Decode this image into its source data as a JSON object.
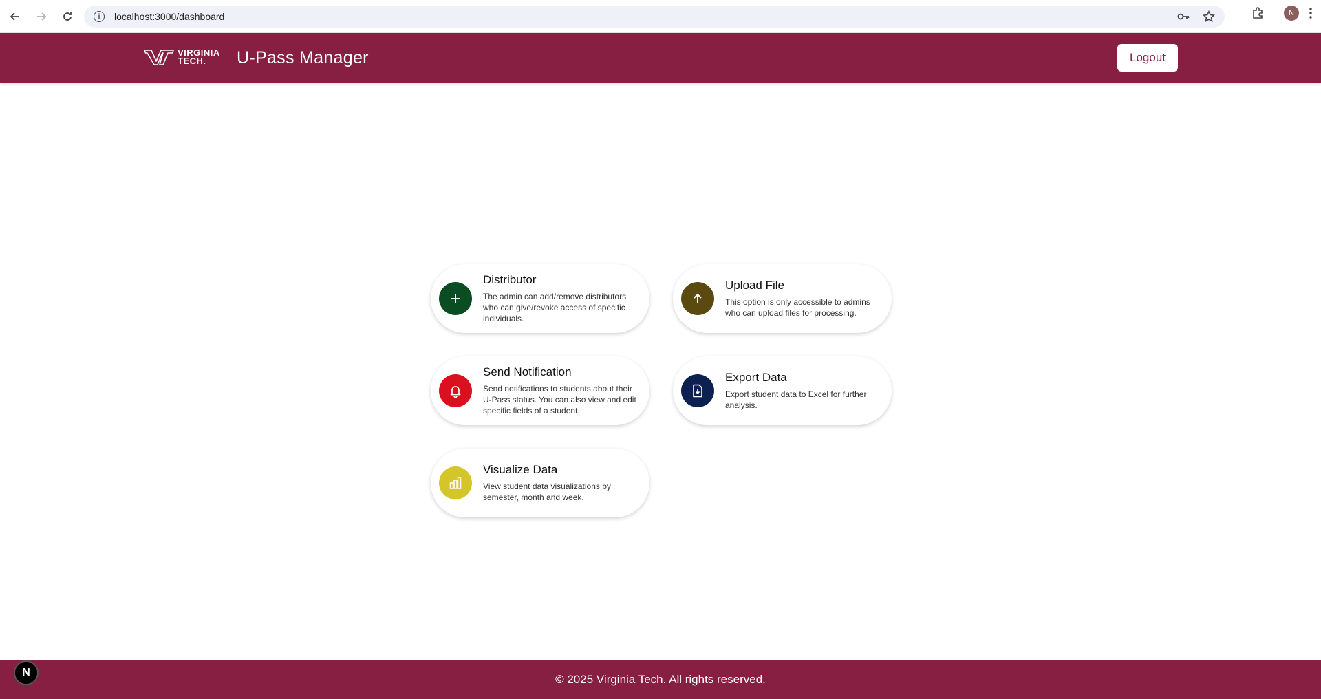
{
  "browser": {
    "url": "localhost:3000/dashboard",
    "profile_initial": "N"
  },
  "header": {
    "logo_line1": "VIRGINIA",
    "logo_line2": "TECH.",
    "title": "U-Pass Manager",
    "logout_label": "Logout"
  },
  "cards": [
    {
      "title": "Distributor",
      "description": "The admin can add/remove distributors who can give/revoke access of specific individuals.",
      "icon": "plus-icon",
      "color": "#0b4d22"
    },
    {
      "title": "Upload File",
      "description": "This option is only accessible to admins who can upload files for processing.",
      "icon": "arrow-up-icon",
      "color": "#5a4a10"
    },
    {
      "title": "Send Notification",
      "description": "Send notifications to students about their U-Pass status. You can also view and edit specific fields of a student.",
      "icon": "bell-icon",
      "color": "#d9101e"
    },
    {
      "title": "Export Data",
      "description": "Export student data to Excel for further analysis.",
      "icon": "file-download-icon",
      "color": "#0c2150"
    },
    {
      "title": "Visualize Data",
      "description": "View student data visualizations by semester, month and week.",
      "icon": "bar-chart-icon",
      "color": "#d4c62a"
    }
  ],
  "footer": {
    "copyright": "© 2025 Virginia Tech. All rights reserved."
  },
  "dev_badge": "N"
}
